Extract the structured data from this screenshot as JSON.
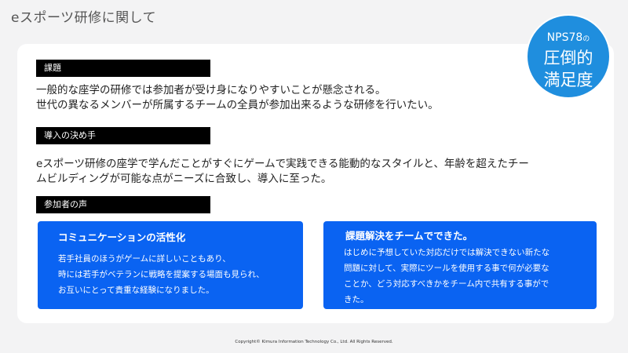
{
  "title": "eスポーツ研修に関して",
  "badge": {
    "line1_main": "NPS78",
    "line1_suffix": "の",
    "line2": "圧倒的",
    "line3": "満足度"
  },
  "sections": {
    "issue": {
      "label": "課題",
      "lines": [
        "一般的な座学の研修では参加者が受け身になりやすいことが懸念される。",
        "世代の異なるメンバーが所属するチームの全員が参加出来るような研修を行いたい。"
      ]
    },
    "deciding_factor": {
      "label": "導入の決め手",
      "lines": [
        "eスポーツ研修の座学で学んだことがすぐにゲームで実践できる能動的なスタイルと、年齢を超えたチー",
        "ムビルディングが可能な点がニーズに合致し、導入に至った。"
      ]
    },
    "voices": {
      "label": "参加者の声"
    }
  },
  "voice_cards": [
    {
      "title": "コミュニケーションの活性化",
      "lines": [
        "若手社員のほうがゲームに詳しいこともあり、",
        "時には若手がベテランに戦略を提案する場面も見られ、",
        "お互いにとって貴重な経験になりました。"
      ]
    },
    {
      "title": "課題解決をチームでできた。",
      "lines": [
        "はじめに予想していた対応だけでは解決できない新たな",
        "問題に対して、実際にツールを使用する事で何が必要な",
        "ことか、どう対応すべきかをチーム内で共有する事がで",
        "きた。"
      ]
    }
  ],
  "copyright": "Copyright© Kimura Information Technology Co., Ltd. All Rights Reserved.",
  "colors": {
    "background": "#f3f3f4",
    "card": "#ffffff",
    "label_bar": "#000000",
    "voice_card": "#0a63f2",
    "badge": "#1f8ede"
  }
}
